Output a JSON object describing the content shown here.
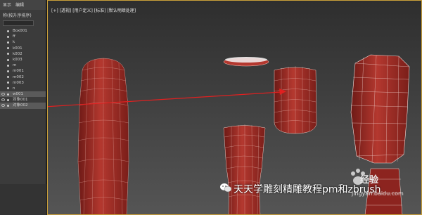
{
  "panel": {
    "menu": [
      "显示",
      "编辑"
    ],
    "title": "称(按升序排序)",
    "items": [
      {
        "label": "Box001",
        "selected": false
      },
      {
        "label": "ff",
        "selected": false
      },
      {
        "label": "k",
        "selected": false
      },
      {
        "label": "k001",
        "selected": false
      },
      {
        "label": "k002",
        "selected": false
      },
      {
        "label": "k003",
        "selected": false
      },
      {
        "label": "m",
        "selected": false
      },
      {
        "label": "m001",
        "selected": false
      },
      {
        "label": "m002",
        "selected": false
      },
      {
        "label": "m003",
        "selected": false
      },
      {
        "label": "n",
        "selected": false
      },
      {
        "label": "w001",
        "selected": true
      },
      {
        "label": "对象001",
        "selected": false
      },
      {
        "label": "对象002",
        "selected": true
      }
    ]
  },
  "viewport": {
    "label": "[+] [透视] [用户定义] [标准] [默认明暗处理]"
  },
  "watermark": {
    "text": "天天学雕刻精雕教程pm和zbrush",
    "brand": "经验",
    "url": "jingyan.baidu.com"
  },
  "colors": {
    "mesh": "#9e2a24",
    "mesh_light": "#c3453c",
    "wire": "#f0c8c0",
    "arrow": "#e02020"
  }
}
